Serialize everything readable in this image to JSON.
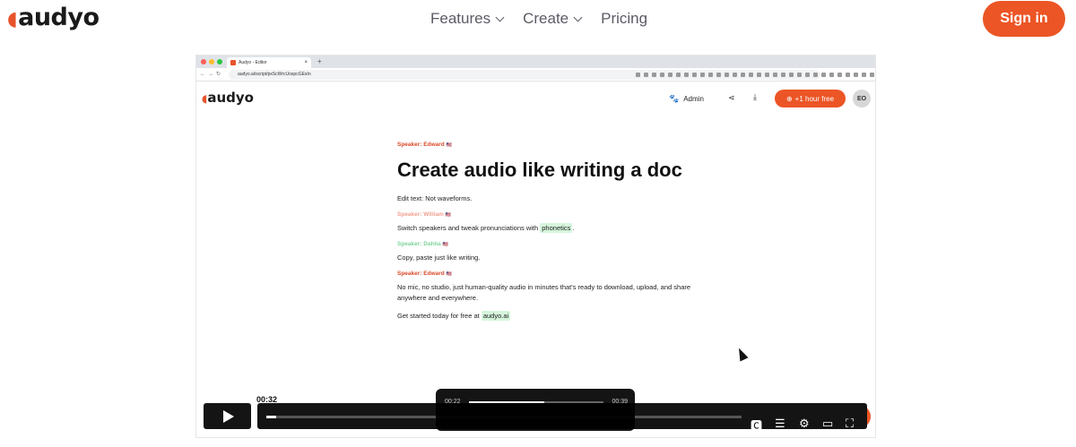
{
  "nav": {
    "logo": "audyo",
    "links": [
      {
        "label": "Features",
        "dropdown": true
      },
      {
        "label": "Create",
        "dropdown": true
      },
      {
        "label": "Pricing",
        "dropdown": false
      }
    ],
    "signin": "Sign in"
  },
  "colors": {
    "accent": "#ec5525",
    "highlight": "#d6f5dc"
  },
  "browser": {
    "tab_title": "Audyo - Editor",
    "url": "audyo.ai/script/pxScWrcUospcGEsIn"
  },
  "app": {
    "logo": "audyo",
    "admin_label": "Admin",
    "free_button": "+1 hour free",
    "avatar": "EO",
    "icons": [
      "paw-icon",
      "share-icon",
      "download-icon",
      "add-user-icon"
    ]
  },
  "doc": {
    "speaker1": "Speaker: Edward",
    "heading": "Create audio like writing a doc",
    "line1": "Edit text: Not waveforms.",
    "speaker2": "Speaker: William",
    "line2_pre": "Switch speakers and tweak pronunciations with",
    "line2_hl": "phonetics",
    "line2_post": ".",
    "speaker3": "Speaker: Dahlia",
    "line3": "Copy, paste just like writing.",
    "speaker4": "Speaker: Edward",
    "line4": "No mic, no studio, just human-quality audio in minutes that's ready to download, upload, and share anywhere and everywhere.",
    "line5_pre": "Get started today for free at",
    "line5_hl": "audyo.ai"
  },
  "player": {
    "current_time": "00:32",
    "progress": 0.02,
    "controls": [
      "cc-icon",
      "transcript-icon",
      "settings-icon",
      "cast-icon",
      "fullscreen-icon"
    ]
  },
  "inner_player": {
    "current_time": "00:22",
    "duration": "00:39",
    "progress": 0.56
  }
}
